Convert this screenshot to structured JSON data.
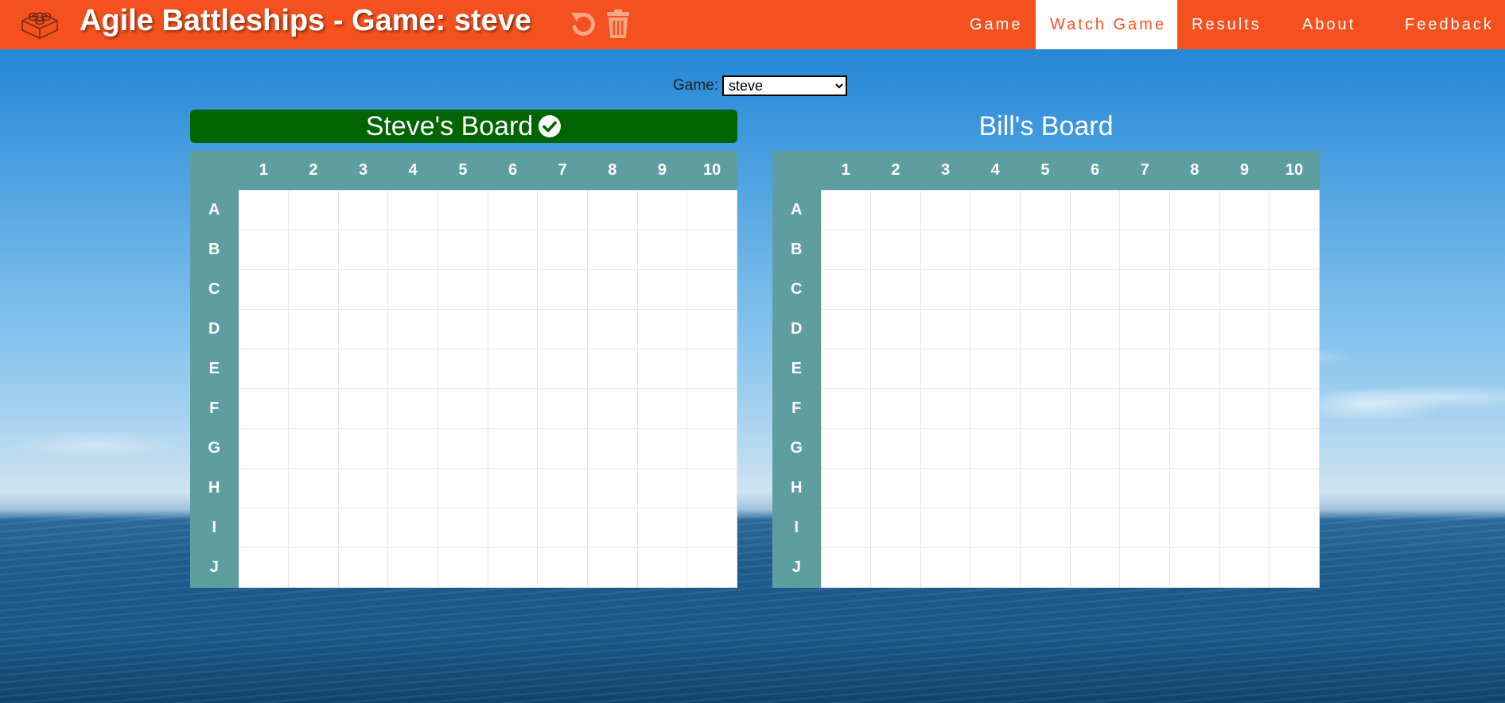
{
  "header": {
    "title": "Agile Battleships - Game: steve",
    "logo_icon": "lego-brick-icon",
    "undo_icon": "undo-icon",
    "delete_icon": "trash-icon",
    "accent_color": "#f4511e"
  },
  "nav": {
    "items": [
      {
        "label": "Game"
      },
      {
        "label": "Watch Game",
        "active": true
      },
      {
        "label": "Results"
      },
      {
        "label": "About"
      },
      {
        "label": "Feedback"
      }
    ]
  },
  "game_select": {
    "label": "Game:",
    "value": "steve"
  },
  "boards": [
    {
      "title": "Steve's Board",
      "active": true,
      "status_icon": "check-circle-icon",
      "active_color": "#006400"
    },
    {
      "title": "Bill's Board",
      "active": false
    }
  ],
  "grid": {
    "columns": [
      "1",
      "2",
      "3",
      "4",
      "5",
      "6",
      "7",
      "8",
      "9",
      "10"
    ],
    "rows": [
      "A",
      "B",
      "C",
      "D",
      "E",
      "F",
      "G",
      "H",
      "I",
      "J"
    ],
    "header_color": "#5f9ea0"
  }
}
